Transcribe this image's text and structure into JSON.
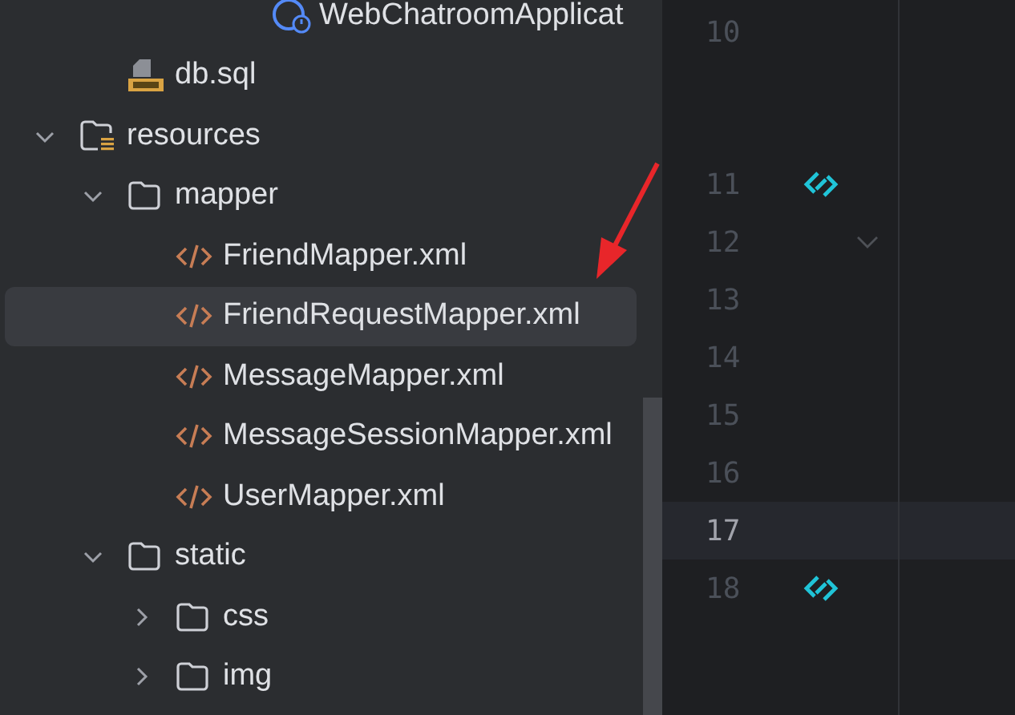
{
  "project_tree": [
    {
      "children": [
        {
          "children": [
            {
              "children": [
                {
                  "children": [
                    {
                      "label": "WebChatroomApplicat",
                      "kind": "spring-class",
                      "selected": false
                    }
                  ]
                }
              ]
            }
          ]
        },
        {
          "label": "db.sql",
          "kind": "sql",
          "selected": false
        }
      ]
    },
    {
      "label": "resources",
      "kind": "resources-folder",
      "expanded": true,
      "selected": false,
      "children": [
        {
          "label": "mapper",
          "kind": "folder",
          "expanded": true,
          "selected": false,
          "children": [
            {
              "label": "FriendMapper.xml",
              "kind": "xml",
              "selected": false
            },
            {
              "label": "FriendRequestMapper.xml",
              "kind": "xml",
              "selected": true
            },
            {
              "label": "MessageMapper.xml",
              "kind": "xml",
              "selected": false
            },
            {
              "label": "MessageSessionMapper.xml",
              "kind": "xml",
              "selected": false
            },
            {
              "label": "UserMapper.xml",
              "kind": "xml",
              "selected": false
            }
          ]
        },
        {
          "label": "static",
          "kind": "folder",
          "expanded": true,
          "selected": false,
          "children": [
            {
              "label": "css",
              "kind": "folder",
              "expanded": false,
              "selected": false
            },
            {
              "label": "img",
              "kind": "folder",
              "expanded": false,
              "selected": false
            }
          ]
        }
      ]
    }
  ],
  "gutter_lines": [
    {
      "number": "10",
      "current": false,
      "gap_after": true,
      "kind": "plain"
    },
    {
      "number": "11",
      "current": false,
      "kind": "bean"
    },
    {
      "number": "12",
      "current": false,
      "kind": "fold"
    },
    {
      "number": "13",
      "current": false,
      "kind": "plain"
    },
    {
      "number": "14",
      "current": false,
      "kind": "plain"
    },
    {
      "number": "15",
      "current": false,
      "kind": "plain"
    },
    {
      "number": "16",
      "current": false,
      "kind": "plain"
    },
    {
      "number": "17",
      "current": true,
      "kind": "plain"
    },
    {
      "number": "18",
      "current": false,
      "kind": "bean"
    }
  ]
}
